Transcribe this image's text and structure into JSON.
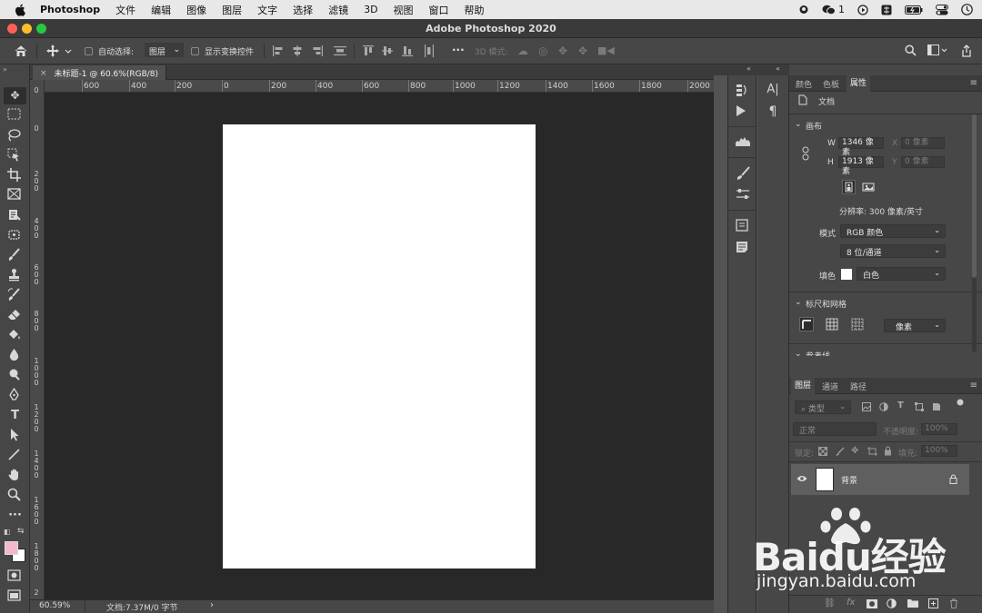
{
  "menubar": {
    "app_name": "Photoshop",
    "items": [
      "文件",
      "编辑",
      "图像",
      "图层",
      "文字",
      "选择",
      "滤镜",
      "3D",
      "视图",
      "窗口",
      "帮助"
    ],
    "wechat_count": "1"
  },
  "window": {
    "title": "Adobe Photoshop 2020"
  },
  "options_bar": {
    "auto_select_label": "自动选择:",
    "auto_select_target": "图层",
    "show_transform_label": "显示变换控件",
    "mode_3d_label": "3D 模式:"
  },
  "document": {
    "tab_title": "未标题-1 @ 60.6%(RGB/8)"
  },
  "rulers": {
    "h_labels": [
      "600",
      "400",
      "200",
      "0",
      "200",
      "400",
      "600",
      "800",
      "1000",
      "1200",
      "1400",
      "1600",
      "1800",
      "2000"
    ],
    "v_labels": [
      "0",
      "0",
      "2\n0\n0",
      "4\n0\n0",
      "6\n0\n0",
      "8\n0\n0",
      "1\n0\n0\n0",
      "1\n2\n0\n0",
      "1\n4\n0\n0",
      "1\n6\n0\n0",
      "1\n8\n0\n0",
      "2"
    ]
  },
  "status": {
    "zoom": "60.59%",
    "doc_info": "文档:7.37M/0 字节"
  },
  "properties_panel": {
    "tabs": [
      "颜色",
      "色板",
      "属性"
    ],
    "active_tab": "属性",
    "doc_label": "文档",
    "canvas_section": "画布",
    "w_label": "W",
    "w_value": "1346 像素",
    "h_label": "H",
    "h_value": "1913 像素",
    "x_label": "X",
    "x_placeholder": "0 像素",
    "y_label": "Y",
    "y_placeholder": "0 像素",
    "resolution": "分辨率: 300 像素/英寸",
    "mode_label": "模式",
    "mode_value": "RGB 颜色",
    "bit_depth": "8 位/通道",
    "fill_label": "填色",
    "fill_value": "白色",
    "rulers_grid_section": "标尺和网格",
    "ruler_unit": "像素",
    "guides_section": "参考线"
  },
  "layers_panel": {
    "tabs": [
      "图层",
      "通道",
      "路径"
    ],
    "active_tab": "图层",
    "filter_label": "类型",
    "blend_mode": "正常",
    "opacity_label": "不透明度:",
    "opacity_value": "100%",
    "lock_label": "锁定:",
    "fill_label": "填充:",
    "fill_value": "100%",
    "layers": [
      {
        "name": "背景",
        "visible": true,
        "locked": true
      }
    ]
  },
  "colors": {
    "foreground": "#f4b8cc",
    "background": "#ffffff",
    "canvas_page": "#ffffff",
    "workspace": "#282828"
  },
  "watermark": {
    "brand": "Baidu经验",
    "url": "jingyan.baidu.com"
  }
}
